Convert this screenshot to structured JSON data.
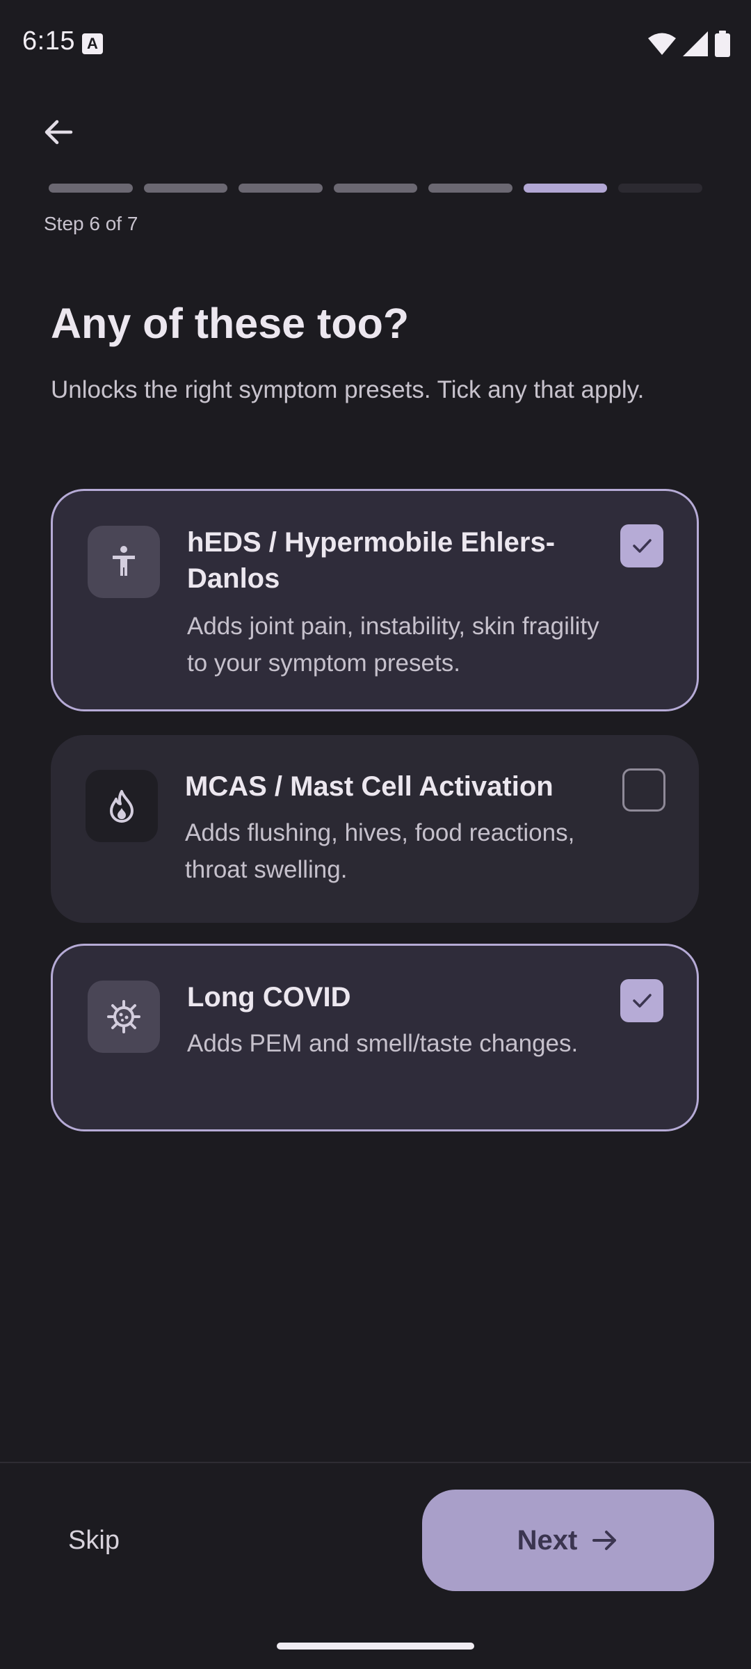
{
  "status_bar": {
    "time": "6:15",
    "notification_icon": "text-a-icon",
    "icons": [
      "wifi-icon",
      "signal-icon",
      "battery-icon"
    ]
  },
  "header": {
    "back_icon": "arrow-left-icon",
    "progress": {
      "total_steps": 7,
      "current_step": 6
    },
    "step_label": "Step 6 of 7"
  },
  "main": {
    "title": "Any of these too?",
    "subtitle": "Unlocks the right symptom presets. Tick any that apply.",
    "options": [
      {
        "icon": "accessibility-figure-icon",
        "title": "hEDS / Hypermobile Ehlers-Danlos",
        "description": "Adds joint pain, instability, skin fragility to your symptom presets.",
        "checked": true
      },
      {
        "icon": "flame-icon",
        "title": "MCAS / Mast Cell Activation",
        "description": "Adds flushing, hives, food reactions, throat swelling.",
        "checked": false
      },
      {
        "icon": "virus-icon",
        "title": "Long COVID",
        "description": "Adds PEM and smell/taste changes.",
        "checked": true
      }
    ]
  },
  "footer": {
    "skip_label": "Skip",
    "next_label": "Next",
    "next_icon": "arrow-right-icon"
  },
  "colors": {
    "background": "#1c1b20",
    "card": "#2b2933",
    "accent": "#b6abd6",
    "next_button": "#a99fc9"
  }
}
